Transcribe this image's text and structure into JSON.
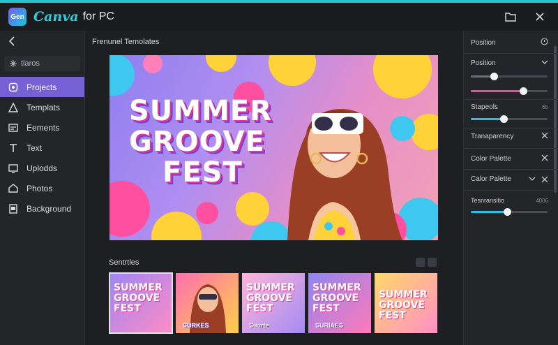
{
  "app": {
    "icon_text": "Gen",
    "brand": "Canva",
    "brand_suffix": "for PC"
  },
  "colors": {
    "accent": "#22c7d0",
    "active_nav": "#7560d6",
    "slider_cyan": "#27c2e6",
    "slider_pink": "#e84ea0"
  },
  "sidebar": {
    "search_placeholder": "tlaros",
    "items": [
      {
        "label": "Projects",
        "icon": "projects-icon",
        "active": true
      },
      {
        "label": "Templats",
        "icon": "templates-icon",
        "active": false
      },
      {
        "label": "Eements",
        "icon": "elements-icon",
        "active": false
      },
      {
        "label": "Text",
        "icon": "text-icon",
        "active": false
      },
      {
        "label": "Uplodds",
        "icon": "uploads-icon",
        "active": false
      },
      {
        "label": "Photos",
        "icon": "photos-icon",
        "active": false
      },
      {
        "label": "Background",
        "icon": "background-icon",
        "active": false
      }
    ]
  },
  "main": {
    "section_title": "Frenunel Temolates",
    "hero": {
      "line1": "SUMMER",
      "line2": "GROOVE",
      "line3": "FEST"
    },
    "thumbs_title": "Sentrtles",
    "thumbs": [
      {
        "l1": "SUMMER",
        "l2": "GROOVE",
        "l3": "FEST",
        "small": ""
      },
      {
        "l1": "",
        "l2": "",
        "l3": "",
        "small": "SURKES"
      },
      {
        "l1": "SUMMER",
        "l2": "GROOVE",
        "l3": "FEST",
        "small": "Suurte"
      },
      {
        "l1": "SUMMER",
        "l2": "GROOVE",
        "l3": "FEST",
        "small": "SURIAES"
      },
      {
        "l1": "SUMMER",
        "l2": "GROOVE",
        "l3": "FEST",
        "small": ""
      }
    ]
  },
  "right_panel": {
    "header": "Position",
    "position_label": "Position",
    "slider1": 0.3,
    "slider2": 0.68,
    "speeds_label": "Stapeols",
    "speeds_value": "65",
    "slider3": 0.43,
    "transparency_label": "Tranaparency",
    "color_palette_1": "Color Palette",
    "color_palette_2": "Calor Palette",
    "transition_label": "Tesnransitio",
    "transition_value": "4006",
    "slider4": 0.47
  }
}
